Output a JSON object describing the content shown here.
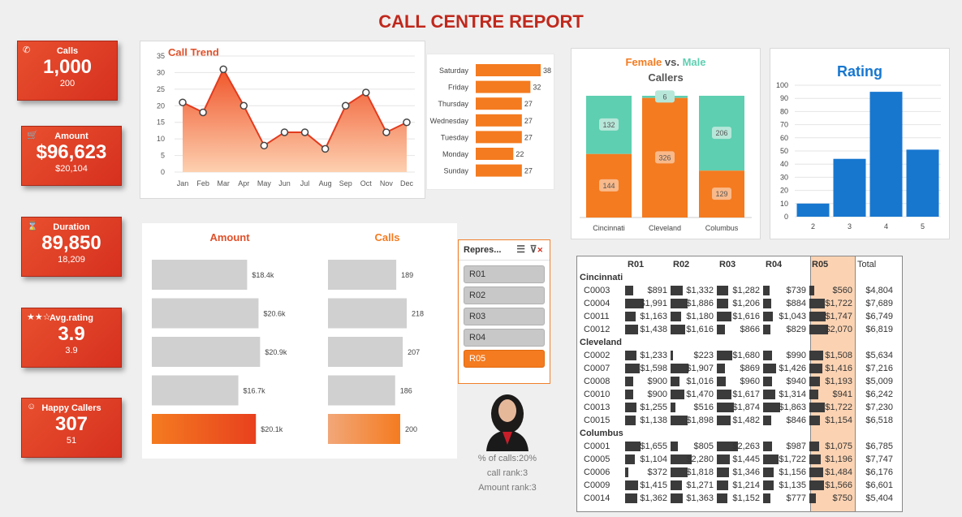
{
  "title": "CALL CENTRE REPORT",
  "colors": {
    "accent": "#f47b20",
    "red": "#d6301f",
    "teal": "#5ecfb1",
    "blue": "#1777cf",
    "gray": "#d0d0d0"
  },
  "kpis": [
    {
      "icon": "phone-icon",
      "glyph": "✆",
      "label": "Calls",
      "value": "1,000",
      "sub": "200"
    },
    {
      "icon": "cart-icon",
      "glyph": "🛒",
      "label": "Amount",
      "value": "$96,623",
      "sub": "$20,104"
    },
    {
      "icon": "hourglass-icon",
      "glyph": "⌛",
      "label": "Duration",
      "value": "89,850",
      "sub": "18,209"
    },
    {
      "icon": "stars-icon",
      "glyph": "★★☆",
      "label": "Avg.rating",
      "value": "3.9",
      "sub": "3.9"
    },
    {
      "icon": "smiley-icon",
      "glyph": "☺",
      "label": "Happy Callers",
      "value": "307",
      "sub": "51"
    }
  ],
  "call_trend": {
    "title": "Call Trend",
    "months": [
      "Jan",
      "Feb",
      "Mar",
      "Apr",
      "May",
      "Jun",
      "Jul",
      "Aug",
      "Sep",
      "Oct",
      "Nov",
      "Dec"
    ],
    "values": [
      21,
      18,
      31,
      20,
      8,
      12,
      12,
      7,
      20,
      24,
      12,
      15
    ],
    "y_ticks": [
      "0",
      "5",
      "10",
      "15",
      "20",
      "25",
      "30",
      "35"
    ]
  },
  "weekday": {
    "days": [
      "Saturday",
      "Friday",
      "Thursday",
      "Wednesday",
      "Tuesday",
      "Monday",
      "Sunday"
    ],
    "values": [
      38,
      32,
      27,
      27,
      27,
      22,
      27
    ]
  },
  "gender": {
    "title_female": "Female",
    "title_vs": " vs. ",
    "title_male": "Male",
    "title_line2": "Callers",
    "cities": [
      "Cincinnati",
      "Cleveland",
      "Columbus"
    ],
    "female": [
      144,
      326,
      129
    ],
    "male": [
      132,
      6,
      206
    ]
  },
  "rating": {
    "title": "Rating",
    "categories": [
      "2",
      "3",
      "4",
      "5"
    ],
    "values": [
      10,
      44,
      95,
      51
    ],
    "y_ticks": [
      "0",
      "10",
      "20",
      "30",
      "40",
      "50",
      "60",
      "70",
      "80",
      "90",
      "100"
    ]
  },
  "rep_bars": {
    "amount_title": "Amount",
    "calls_title": "Calls",
    "amount_values": [
      18.4,
      20.6,
      20.9,
      16.7,
      20.1
    ],
    "amount_labels": [
      "$18.4k",
      "$20.6k",
      "$20.9k",
      "$16.7k",
      "$20.1k"
    ],
    "calls_values": [
      189,
      218,
      207,
      186,
      200
    ],
    "calls_labels": [
      "189",
      "218",
      "207",
      "186",
      "200"
    ],
    "selected_index": 4
  },
  "slicer": {
    "header": "Repres...",
    "items": [
      "R01",
      "R02",
      "R03",
      "R04",
      "R05"
    ],
    "selected": "R05"
  },
  "rep_stats": {
    "pct_calls": "% of calls:20%",
    "call_rank": "call rank:3",
    "amount_rank": "Amount rank:3"
  },
  "pivot": {
    "columns": [
      "R01",
      "R02",
      "R03",
      "R04",
      "R05",
      "Total"
    ],
    "groups": [
      {
        "city": "Cincinnati",
        "rows": [
          {
            "id": "C0003",
            "cells": [
              "$891",
              "$1,332",
              "$1,282",
              "$739",
              "$560",
              "$4,804"
            ],
            "raw": [
              891,
              1332,
              1282,
              739,
              560
            ]
          },
          {
            "id": "C0004",
            "cells": [
              "$1,991",
              "$1,886",
              "$1,206",
              "$884",
              "$1,722",
              "$7,689"
            ],
            "raw": [
              1991,
              1886,
              1206,
              884,
              1722
            ]
          },
          {
            "id": "C0011",
            "cells": [
              "$1,163",
              "$1,180",
              "$1,616",
              "$1,043",
              "$1,747",
              "$6,749"
            ],
            "raw": [
              1163,
              1180,
              1616,
              1043,
              1747
            ]
          },
          {
            "id": "C0012",
            "cells": [
              "$1,438",
              "$1,616",
              "$866",
              "$829",
              "$2,070",
              "$6,819"
            ],
            "raw": [
              1438,
              1616,
              866,
              829,
              2070
            ]
          }
        ]
      },
      {
        "city": "Cleveland",
        "rows": [
          {
            "id": "C0002",
            "cells": [
              "$1,233",
              "$223",
              "$1,680",
              "$990",
              "$1,508",
              "$5,634"
            ],
            "raw": [
              1233,
              223,
              1680,
              990,
              1508
            ]
          },
          {
            "id": "C0007",
            "cells": [
              "$1,598",
              "$1,907",
              "$869",
              "$1,426",
              "$1,416",
              "$7,216"
            ],
            "raw": [
              1598,
              1907,
              869,
              1426,
              1416
            ]
          },
          {
            "id": "C0008",
            "cells": [
              "$900",
              "$1,016",
              "$960",
              "$940",
              "$1,193",
              "$5,009"
            ],
            "raw": [
              900,
              1016,
              960,
              940,
              1193
            ]
          },
          {
            "id": "C0010",
            "cells": [
              "$900",
              "$1,470",
              "$1,617",
              "$1,314",
              "$941",
              "$6,242"
            ],
            "raw": [
              900,
              1470,
              1617,
              1314,
              941
            ]
          },
          {
            "id": "C0013",
            "cells": [
              "$1,255",
              "$516",
              "$1,874",
              "$1,863",
              "$1,722",
              "$7,230"
            ],
            "raw": [
              1255,
              516,
              1874,
              1863,
              1722
            ]
          },
          {
            "id": "C0015",
            "cells": [
              "$1,138",
              "$1,898",
              "$1,482",
              "$846",
              "$1,154",
              "$6,518"
            ],
            "raw": [
              1138,
              1898,
              1482,
              846,
              1154
            ]
          }
        ]
      },
      {
        "city": "Columbus",
        "rows": [
          {
            "id": "C0001",
            "cells": [
              "$1,655",
              "$805",
              "$2,263",
              "$987",
              "$1,075",
              "$6,785"
            ],
            "raw": [
              1655,
              805,
              2263,
              987,
              1075
            ]
          },
          {
            "id": "C0005",
            "cells": [
              "$1,104",
              "$2,280",
              "$1,445",
              "$1,722",
              "$1,196",
              "$7,747"
            ],
            "raw": [
              1104,
              2280,
              1445,
              1722,
              1196
            ]
          },
          {
            "id": "C0006",
            "cells": [
              "$372",
              "$1,818",
              "$1,346",
              "$1,156",
              "$1,484",
              "$6,176"
            ],
            "raw": [
              372,
              1818,
              1346,
              1156,
              1484
            ]
          },
          {
            "id": "C0009",
            "cells": [
              "$1,415",
              "$1,271",
              "$1,214",
              "$1,135",
              "$1,566",
              "$6,601"
            ],
            "raw": [
              1415,
              1271,
              1214,
              1135,
              1566
            ]
          },
          {
            "id": "C0014",
            "cells": [
              "$1,362",
              "$1,363",
              "$1,152",
              "$777",
              "$750",
              "$5,404"
            ],
            "raw": [
              1362,
              1363,
              1152,
              777,
              750
            ]
          }
        ]
      }
    ]
  }
}
